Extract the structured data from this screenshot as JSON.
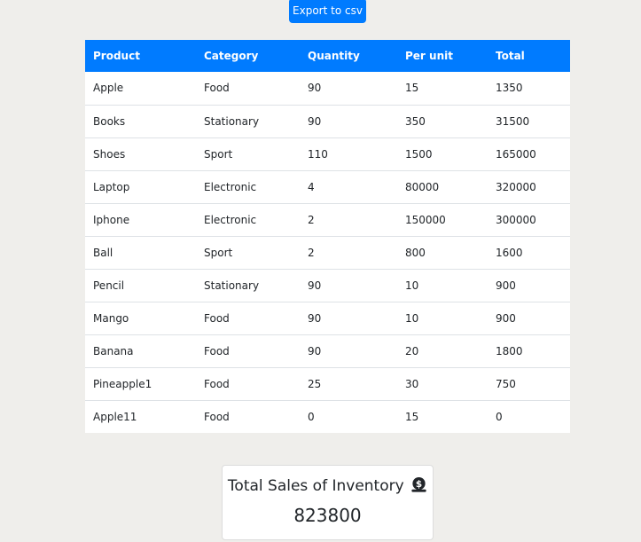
{
  "toolbar": {
    "export_label": "Export to csv"
  },
  "table": {
    "headers": [
      "Product",
      "Category",
      "Quantity",
      "Per unit",
      "Total"
    ],
    "rows": [
      [
        "Apple",
        "Food",
        "90",
        "15",
        "1350"
      ],
      [
        "Books",
        "Stationary",
        "90",
        "350",
        "31500"
      ],
      [
        "Shoes",
        "Sport",
        "110",
        "1500",
        "165000"
      ],
      [
        "Laptop",
        "Electronic",
        "4",
        "80000",
        "320000"
      ],
      [
        "Iphone",
        "Electronic",
        "2",
        "150000",
        "300000"
      ],
      [
        "Ball",
        "Sport",
        "2",
        "800",
        "1600"
      ],
      [
        "Pencil",
        "Stationary",
        "90",
        "10",
        "900"
      ],
      [
        "Mango",
        "Food",
        "90",
        "10",
        "900"
      ],
      [
        "Banana",
        "Food",
        "90",
        "20",
        "1800"
      ],
      [
        "Pineapple1",
        "Food",
        "25",
        "30",
        "750"
      ],
      [
        "Apple11",
        "Food",
        "0",
        "15",
        "0"
      ]
    ]
  },
  "summary": {
    "title": "Total Sales of Inventory",
    "icon": "money-bag-icon",
    "value": "823800"
  },
  "colors": {
    "accent": "#007bff",
    "background": "#efeeeb"
  }
}
